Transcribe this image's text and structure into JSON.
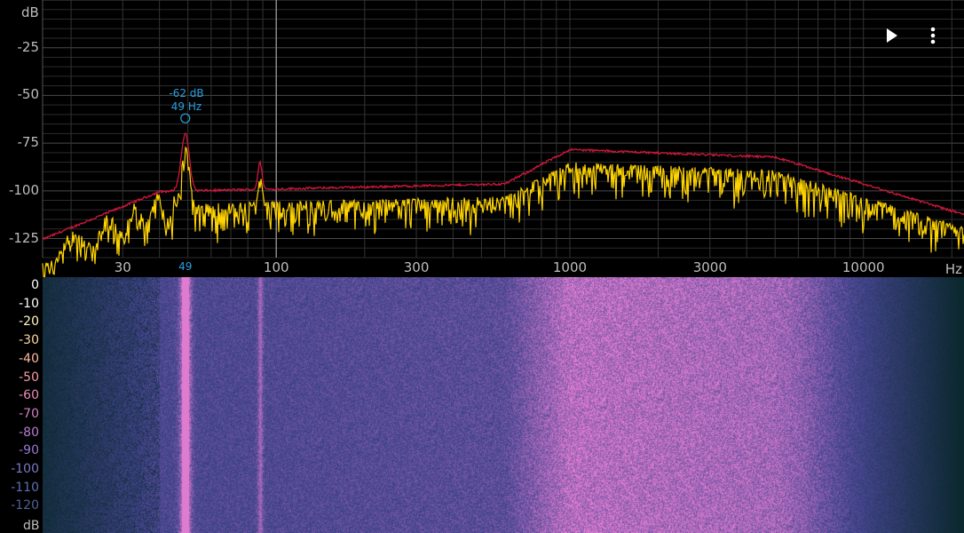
{
  "spectrum": {
    "db_unit": "dB",
    "hz_unit": "Hz",
    "db_ticks": [
      "-25",
      "-50",
      "-75",
      "-100",
      "-125"
    ],
    "db_tick_values": [
      -25,
      -50,
      -75,
      -100,
      -125
    ],
    "db_range": [
      -135,
      0
    ],
    "hz_ticks": [
      "30",
      "100",
      "300",
      "1000",
      "3000",
      "10000"
    ],
    "hz_tick_values": [
      30,
      100,
      300,
      1000,
      3000,
      10000
    ],
    "hz_range": [
      16,
      22000
    ],
    "peak": {
      "db_label": "-62 dB",
      "hz_label": "49 Hz",
      "axis_label": "49",
      "hz": 49,
      "db": -62
    },
    "colors": {
      "live": "#ffd400",
      "peak_hold": "#d0173c",
      "grid": "#3a3a3a",
      "cursor": "#8a8a8a",
      "peak_marker": "#2a9fe0"
    }
  },
  "toolbar": {
    "play_icon": "play-icon",
    "more_icon": "more-vert-icon"
  },
  "waterfall": {
    "db_unit": "dB",
    "ticks": [
      {
        "label": "0",
        "color": "#ffffff"
      },
      {
        "label": "-10",
        "color": "#ffffff"
      },
      {
        "label": "-20",
        "color": "#fff6c8"
      },
      {
        "label": "-30",
        "color": "#ffd7a0"
      },
      {
        "label": "-40",
        "color": "#ffb8a0"
      },
      {
        "label": "-50",
        "color": "#f79aa8"
      },
      {
        "label": "-60",
        "color": "#e98ab7"
      },
      {
        "label": "-70",
        "color": "#d47fc6"
      },
      {
        "label": "-80",
        "color": "#b67cd0"
      },
      {
        "label": "-90",
        "color": "#957ad0"
      },
      {
        "label": "-100",
        "color": "#7a78c8"
      },
      {
        "label": "-110",
        "color": "#5f6fb6"
      },
      {
        "label": "-120",
        "color": "#4c6298"
      }
    ]
  }
}
